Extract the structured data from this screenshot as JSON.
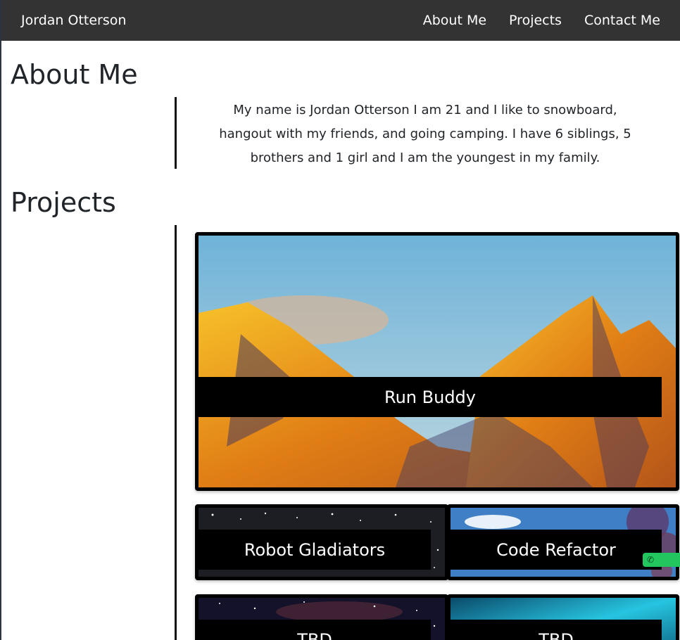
{
  "navbar": {
    "brand": "Jordan Otterson",
    "links": [
      "About Me",
      "Projects",
      "Contact Me"
    ]
  },
  "about": {
    "title": "About Me",
    "text": "My name is Jordan Otterson I am 21 and I like to snowboard, hangout with my friends, and going camping. I have 6 siblings, 5 brothers and 1 girl and I am the youngest in my family."
  },
  "projects": {
    "title": "Projects",
    "cards": [
      {
        "label": "Run Buddy",
        "image": "mountain-sunset-image"
      },
      {
        "label": "Robot Gladiators",
        "image": "night-sky-image"
      },
      {
        "label": "Code Refactor",
        "image": "blue-sky-tree-image"
      },
      {
        "label": "TBD",
        "image": "starry-galaxy-image"
      },
      {
        "label": "TBD",
        "image": "aurora-image"
      }
    ]
  },
  "widget": {
    "icon": "phone-icon",
    "color": "#22c55e"
  }
}
